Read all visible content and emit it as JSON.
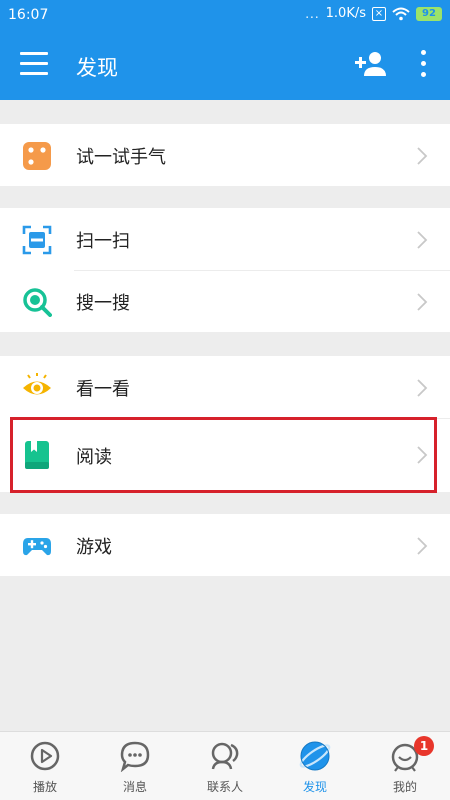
{
  "status_bar": {
    "time": "16:07",
    "dots": "...",
    "speed": "1.0K/s",
    "battery": "92"
  },
  "header": {
    "title": "发现",
    "icons": [
      "menu-icon",
      "add-user-icon",
      "more-vertical-icon"
    ]
  },
  "groups": [
    {
      "items": [
        {
          "label": "试一试手气",
          "icon": "dice-icon",
          "color": "#f59a4a"
        }
      ]
    },
    {
      "items": [
        {
          "label": "扫一扫",
          "icon": "scan-icon",
          "color": "#2b9ae9"
        },
        {
          "label": "搜一搜",
          "icon": "search-icon",
          "color": "#17c296"
        }
      ]
    },
    {
      "items": [
        {
          "label": "看一看",
          "icon": "eye-icon",
          "color": "#f5b400"
        },
        {
          "label": "阅读",
          "icon": "book-icon",
          "color": "#16c38f"
        }
      ]
    },
    {
      "items": [
        {
          "label": "游戏",
          "icon": "gamepad-icon",
          "color": "#2aa4e8"
        }
      ]
    }
  ],
  "tabs": [
    {
      "label": "播放",
      "icon": "play-icon",
      "active": false
    },
    {
      "label": "消息",
      "icon": "message-icon",
      "active": false
    },
    {
      "label": "联系人",
      "icon": "contacts-icon",
      "active": false
    },
    {
      "label": "发现",
      "icon": "discover-icon",
      "active": true
    },
    {
      "label": "我的",
      "icon": "me-icon",
      "active": false,
      "badge": "1"
    }
  ],
  "colors": {
    "primary": "#1f93ea",
    "highlight_border": "#d6212b",
    "badge": "#e8362b"
  }
}
